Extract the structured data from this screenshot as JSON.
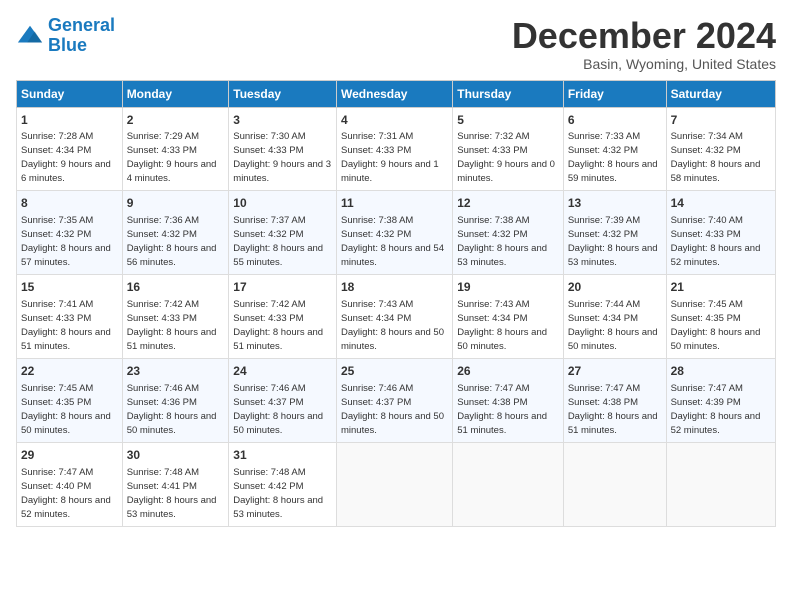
{
  "logo": {
    "line1": "General",
    "line2": "Blue"
  },
  "title": "December 2024",
  "subtitle": "Basin, Wyoming, United States",
  "days_of_week": [
    "Sunday",
    "Monday",
    "Tuesday",
    "Wednesday",
    "Thursday",
    "Friday",
    "Saturday"
  ],
  "weeks": [
    [
      {
        "day": 1,
        "sunrise": "7:28 AM",
        "sunset": "4:34 PM",
        "daylight": "9 hours and 6 minutes."
      },
      {
        "day": 2,
        "sunrise": "7:29 AM",
        "sunset": "4:33 PM",
        "daylight": "9 hours and 4 minutes."
      },
      {
        "day": 3,
        "sunrise": "7:30 AM",
        "sunset": "4:33 PM",
        "daylight": "9 hours and 3 minutes."
      },
      {
        "day": 4,
        "sunrise": "7:31 AM",
        "sunset": "4:33 PM",
        "daylight": "9 hours and 1 minute."
      },
      {
        "day": 5,
        "sunrise": "7:32 AM",
        "sunset": "4:33 PM",
        "daylight": "9 hours and 0 minutes."
      },
      {
        "day": 6,
        "sunrise": "7:33 AM",
        "sunset": "4:32 PM",
        "daylight": "8 hours and 59 minutes."
      },
      {
        "day": 7,
        "sunrise": "7:34 AM",
        "sunset": "4:32 PM",
        "daylight": "8 hours and 58 minutes."
      }
    ],
    [
      {
        "day": 8,
        "sunrise": "7:35 AM",
        "sunset": "4:32 PM",
        "daylight": "8 hours and 57 minutes."
      },
      {
        "day": 9,
        "sunrise": "7:36 AM",
        "sunset": "4:32 PM",
        "daylight": "8 hours and 56 minutes."
      },
      {
        "day": 10,
        "sunrise": "7:37 AM",
        "sunset": "4:32 PM",
        "daylight": "8 hours and 55 minutes."
      },
      {
        "day": 11,
        "sunrise": "7:38 AM",
        "sunset": "4:32 PM",
        "daylight": "8 hours and 54 minutes."
      },
      {
        "day": 12,
        "sunrise": "7:38 AM",
        "sunset": "4:32 PM",
        "daylight": "8 hours and 53 minutes."
      },
      {
        "day": 13,
        "sunrise": "7:39 AM",
        "sunset": "4:32 PM",
        "daylight": "8 hours and 53 minutes."
      },
      {
        "day": 14,
        "sunrise": "7:40 AM",
        "sunset": "4:33 PM",
        "daylight": "8 hours and 52 minutes."
      }
    ],
    [
      {
        "day": 15,
        "sunrise": "7:41 AM",
        "sunset": "4:33 PM",
        "daylight": "8 hours and 51 minutes."
      },
      {
        "day": 16,
        "sunrise": "7:42 AM",
        "sunset": "4:33 PM",
        "daylight": "8 hours and 51 minutes."
      },
      {
        "day": 17,
        "sunrise": "7:42 AM",
        "sunset": "4:33 PM",
        "daylight": "8 hours and 51 minutes."
      },
      {
        "day": 18,
        "sunrise": "7:43 AM",
        "sunset": "4:34 PM",
        "daylight": "8 hours and 50 minutes."
      },
      {
        "day": 19,
        "sunrise": "7:43 AM",
        "sunset": "4:34 PM",
        "daylight": "8 hours and 50 minutes."
      },
      {
        "day": 20,
        "sunrise": "7:44 AM",
        "sunset": "4:34 PM",
        "daylight": "8 hours and 50 minutes."
      },
      {
        "day": 21,
        "sunrise": "7:45 AM",
        "sunset": "4:35 PM",
        "daylight": "8 hours and 50 minutes."
      }
    ],
    [
      {
        "day": 22,
        "sunrise": "7:45 AM",
        "sunset": "4:35 PM",
        "daylight": "8 hours and 50 minutes."
      },
      {
        "day": 23,
        "sunrise": "7:46 AM",
        "sunset": "4:36 PM",
        "daylight": "8 hours and 50 minutes."
      },
      {
        "day": 24,
        "sunrise": "7:46 AM",
        "sunset": "4:37 PM",
        "daylight": "8 hours and 50 minutes."
      },
      {
        "day": 25,
        "sunrise": "7:46 AM",
        "sunset": "4:37 PM",
        "daylight": "8 hours and 50 minutes."
      },
      {
        "day": 26,
        "sunrise": "7:47 AM",
        "sunset": "4:38 PM",
        "daylight": "8 hours and 51 minutes."
      },
      {
        "day": 27,
        "sunrise": "7:47 AM",
        "sunset": "4:38 PM",
        "daylight": "8 hours and 51 minutes."
      },
      {
        "day": 28,
        "sunrise": "7:47 AM",
        "sunset": "4:39 PM",
        "daylight": "8 hours and 52 minutes."
      }
    ],
    [
      {
        "day": 29,
        "sunrise": "7:47 AM",
        "sunset": "4:40 PM",
        "daylight": "8 hours and 52 minutes."
      },
      {
        "day": 30,
        "sunrise": "7:48 AM",
        "sunset": "4:41 PM",
        "daylight": "8 hours and 53 minutes."
      },
      {
        "day": 31,
        "sunrise": "7:48 AM",
        "sunset": "4:42 PM",
        "daylight": "8 hours and 53 minutes."
      },
      null,
      null,
      null,
      null
    ]
  ]
}
